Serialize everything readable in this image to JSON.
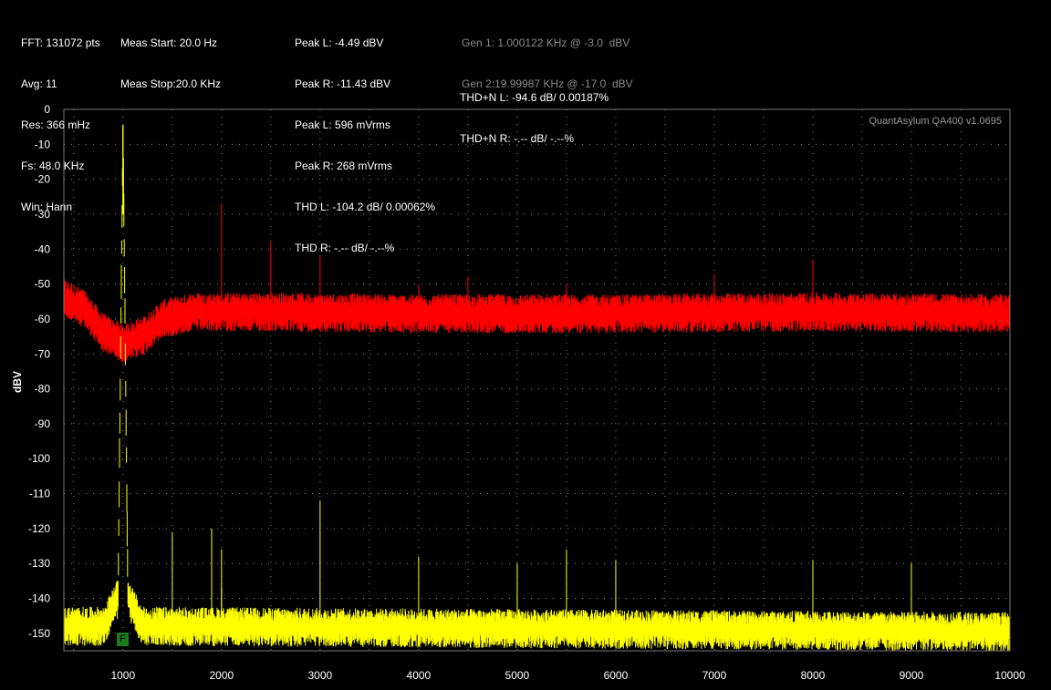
{
  "status": {
    "col1": [
      "FFT: 131072 pts",
      "Avg: 11",
      "Res: 366 mHz",
      "Fs: 48.0 KHz",
      "Win: Hann"
    ],
    "col2": [
      "Meas Start: 20.0 Hz",
      "Meas Stop:20.0 KHz"
    ],
    "col3": [
      "Peak L: -4.49 dBV",
      "Peak R: -11.43 dBV",
      "Peak L: 596 mVrms",
      "Peak R: 268 mVrms",
      "THD L: -104.2 dB/ 0.00062%",
      "THD R: -.-- dB/ -.--%"
    ],
    "col4": [
      "THD+N L: -94.6 dB/ 0.00187%",
      "THD+N R: -.-- dB/ -.--%"
    ],
    "gen": [
      "Gen 1: 1.000122 KHz @ -3.0  dBV",
      "Gen 2:19.99987 KHz @ -17.0  dBV"
    ]
  },
  "watermark": "QuantAsylum QA400 v1.0695",
  "marker_label": "F",
  "colors": {
    "left_channel": "#ffff00",
    "right_channel": "#ff0000",
    "grid": "#8a8a8a",
    "gen_text": "#8a8a8a",
    "marker": "#1d7a1d"
  },
  "chart_data": {
    "type": "line",
    "title": "",
    "xlabel": "",
    "ylabel": "dBV",
    "xlim": [
      400,
      10000
    ],
    "ylim": [
      -155,
      0
    ],
    "x_ticks": [
      1000,
      2000,
      3000,
      4000,
      5000,
      6000,
      7000,
      8000,
      9000,
      10000
    ],
    "y_ticks": [
      0,
      -10,
      -20,
      -30,
      -40,
      -50,
      -60,
      -70,
      -80,
      -90,
      -100,
      -110,
      -120,
      -130,
      -140,
      -150
    ],
    "grid": true,
    "series": [
      {
        "channel": "R",
        "color": "#ff0000",
        "noise_floor": [
          [
            400,
            -54
          ],
          [
            600,
            -57
          ],
          [
            800,
            -64
          ],
          [
            1000,
            -67
          ],
          [
            1200,
            -65
          ],
          [
            1400,
            -60
          ],
          [
            1700,
            -58
          ],
          [
            2500,
            -58
          ],
          [
            4000,
            -58.5
          ],
          [
            6000,
            -58.5
          ],
          [
            8000,
            -58
          ],
          [
            10000,
            -58.5
          ]
        ],
        "spikes": [
          [
            2000,
            -27
          ],
          [
            4000,
            -50
          ],
          [
            2500,
            -38
          ],
          [
            3000,
            -42
          ],
          [
            4500,
            -48
          ],
          [
            5500,
            -50
          ],
          [
            7000,
            -47
          ],
          [
            8000,
            -43
          ],
          [
            1000,
            -64
          ]
        ]
      },
      {
        "channel": "L",
        "color": "#ffff00",
        "noise_floor": [
          [
            400,
            -148
          ],
          [
            800,
            -148
          ],
          [
            950,
            -140
          ],
          [
            1000,
            -4.5
          ],
          [
            1050,
            -140
          ],
          [
            1200,
            -148
          ],
          [
            10000,
            -149.5
          ]
        ],
        "spikes": [
          [
            1000,
            -4.5
          ],
          [
            2000,
            -137
          ],
          [
            1500,
            -121
          ],
          [
            1900,
            -120
          ],
          [
            2000,
            -126
          ],
          [
            3000,
            -112
          ],
          [
            4000,
            -128
          ],
          [
            5000,
            -130
          ],
          [
            5500,
            -126
          ],
          [
            6000,
            -129
          ],
          [
            8000,
            -129
          ],
          [
            9000,
            -130
          ]
        ]
      }
    ]
  }
}
